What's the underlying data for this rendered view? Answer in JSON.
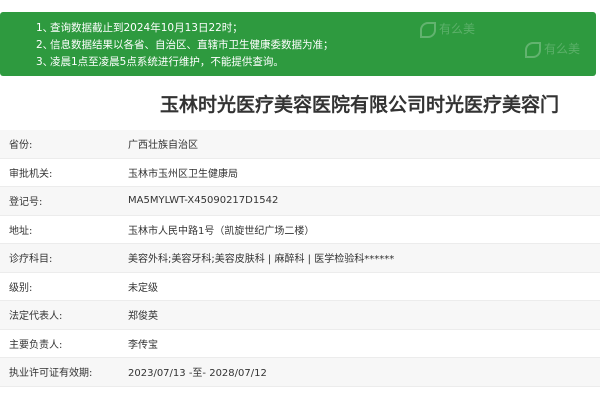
{
  "notice": {
    "items": [
      {
        "num": "1、",
        "text": "查询数据截止到2024年10月13日22时；"
      },
      {
        "num": "2、",
        "text": "信息数据结果以各省、自治区、直辖市卫生健康委数据为准；"
      },
      {
        "num": "3、",
        "text": "凌晨1点至凌晨5点系统进行维护，不能提供查询。"
      }
    ],
    "watermark": "有么美"
  },
  "title": "玉林时光医疗美容医院有限公司时光医疗美容门",
  "fields": [
    {
      "label": "省份:",
      "value": "广西壮族自治区"
    },
    {
      "label": "审批机关:",
      "value": "玉林市玉州区卫生健康局"
    },
    {
      "label": "登记号:",
      "value": "MA5MYLWT-X45090217D1542"
    },
    {
      "label": "地址:",
      "value": "玉林市人民中路1号（凯旋世纪广场二楼）"
    },
    {
      "label": "诊疗科目:",
      "value": "美容外科;美容牙科;美容皮肤科 | 麻醉科 | 医学检验科******"
    },
    {
      "label": "级别:",
      "value": "未定级"
    },
    {
      "label": "法定代表人:",
      "value": "郑俊英"
    },
    {
      "label": "主要负责人:",
      "value": "李传宝"
    },
    {
      "label": "执业许可证有效期:",
      "value": "2023/07/13 -至- 2028/07/12"
    }
  ]
}
